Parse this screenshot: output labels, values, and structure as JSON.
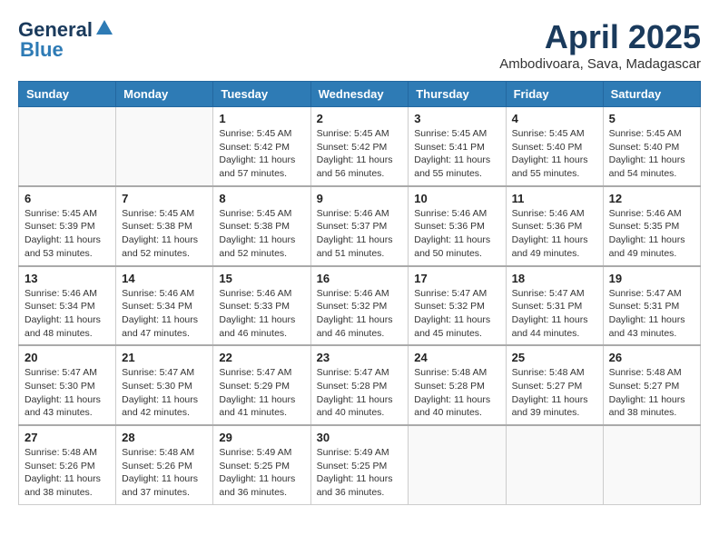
{
  "header": {
    "logo_general": "General",
    "logo_blue": "Blue",
    "month": "April 2025",
    "location": "Ambodivoara, Sava, Madagascar"
  },
  "days_of_week": [
    "Sunday",
    "Monday",
    "Tuesday",
    "Wednesday",
    "Thursday",
    "Friday",
    "Saturday"
  ],
  "weeks": [
    [
      {
        "day": "",
        "info": ""
      },
      {
        "day": "",
        "info": ""
      },
      {
        "day": "1",
        "info": "Sunrise: 5:45 AM\nSunset: 5:42 PM\nDaylight: 11 hours and 57 minutes."
      },
      {
        "day": "2",
        "info": "Sunrise: 5:45 AM\nSunset: 5:42 PM\nDaylight: 11 hours and 56 minutes."
      },
      {
        "day": "3",
        "info": "Sunrise: 5:45 AM\nSunset: 5:41 PM\nDaylight: 11 hours and 55 minutes."
      },
      {
        "day": "4",
        "info": "Sunrise: 5:45 AM\nSunset: 5:40 PM\nDaylight: 11 hours and 55 minutes."
      },
      {
        "day": "5",
        "info": "Sunrise: 5:45 AM\nSunset: 5:40 PM\nDaylight: 11 hours and 54 minutes."
      }
    ],
    [
      {
        "day": "6",
        "info": "Sunrise: 5:45 AM\nSunset: 5:39 PM\nDaylight: 11 hours and 53 minutes."
      },
      {
        "day": "7",
        "info": "Sunrise: 5:45 AM\nSunset: 5:38 PM\nDaylight: 11 hours and 52 minutes."
      },
      {
        "day": "8",
        "info": "Sunrise: 5:45 AM\nSunset: 5:38 PM\nDaylight: 11 hours and 52 minutes."
      },
      {
        "day": "9",
        "info": "Sunrise: 5:46 AM\nSunset: 5:37 PM\nDaylight: 11 hours and 51 minutes."
      },
      {
        "day": "10",
        "info": "Sunrise: 5:46 AM\nSunset: 5:36 PM\nDaylight: 11 hours and 50 minutes."
      },
      {
        "day": "11",
        "info": "Sunrise: 5:46 AM\nSunset: 5:36 PM\nDaylight: 11 hours and 49 minutes."
      },
      {
        "day": "12",
        "info": "Sunrise: 5:46 AM\nSunset: 5:35 PM\nDaylight: 11 hours and 49 minutes."
      }
    ],
    [
      {
        "day": "13",
        "info": "Sunrise: 5:46 AM\nSunset: 5:34 PM\nDaylight: 11 hours and 48 minutes."
      },
      {
        "day": "14",
        "info": "Sunrise: 5:46 AM\nSunset: 5:34 PM\nDaylight: 11 hours and 47 minutes."
      },
      {
        "day": "15",
        "info": "Sunrise: 5:46 AM\nSunset: 5:33 PM\nDaylight: 11 hours and 46 minutes."
      },
      {
        "day": "16",
        "info": "Sunrise: 5:46 AM\nSunset: 5:32 PM\nDaylight: 11 hours and 46 minutes."
      },
      {
        "day": "17",
        "info": "Sunrise: 5:47 AM\nSunset: 5:32 PM\nDaylight: 11 hours and 45 minutes."
      },
      {
        "day": "18",
        "info": "Sunrise: 5:47 AM\nSunset: 5:31 PM\nDaylight: 11 hours and 44 minutes."
      },
      {
        "day": "19",
        "info": "Sunrise: 5:47 AM\nSunset: 5:31 PM\nDaylight: 11 hours and 43 minutes."
      }
    ],
    [
      {
        "day": "20",
        "info": "Sunrise: 5:47 AM\nSunset: 5:30 PM\nDaylight: 11 hours and 43 minutes."
      },
      {
        "day": "21",
        "info": "Sunrise: 5:47 AM\nSunset: 5:30 PM\nDaylight: 11 hours and 42 minutes."
      },
      {
        "day": "22",
        "info": "Sunrise: 5:47 AM\nSunset: 5:29 PM\nDaylight: 11 hours and 41 minutes."
      },
      {
        "day": "23",
        "info": "Sunrise: 5:47 AM\nSunset: 5:28 PM\nDaylight: 11 hours and 40 minutes."
      },
      {
        "day": "24",
        "info": "Sunrise: 5:48 AM\nSunset: 5:28 PM\nDaylight: 11 hours and 40 minutes."
      },
      {
        "day": "25",
        "info": "Sunrise: 5:48 AM\nSunset: 5:27 PM\nDaylight: 11 hours and 39 minutes."
      },
      {
        "day": "26",
        "info": "Sunrise: 5:48 AM\nSunset: 5:27 PM\nDaylight: 11 hours and 38 minutes."
      }
    ],
    [
      {
        "day": "27",
        "info": "Sunrise: 5:48 AM\nSunset: 5:26 PM\nDaylight: 11 hours and 38 minutes."
      },
      {
        "day": "28",
        "info": "Sunrise: 5:48 AM\nSunset: 5:26 PM\nDaylight: 11 hours and 37 minutes."
      },
      {
        "day": "29",
        "info": "Sunrise: 5:49 AM\nSunset: 5:25 PM\nDaylight: 11 hours and 36 minutes."
      },
      {
        "day": "30",
        "info": "Sunrise: 5:49 AM\nSunset: 5:25 PM\nDaylight: 11 hours and 36 minutes."
      },
      {
        "day": "",
        "info": ""
      },
      {
        "day": "",
        "info": ""
      },
      {
        "day": "",
        "info": ""
      }
    ]
  ]
}
